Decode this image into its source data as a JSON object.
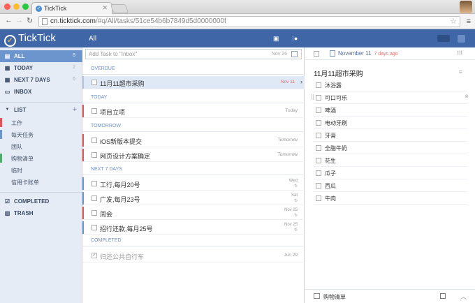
{
  "browser": {
    "tab_title": "TickTick",
    "url_host": "cn.ticktick.com",
    "url_path": "/#q/All/tasks/51ce54b6b7849d5d0000000f",
    "traffic_colors": [
      "#ff5f57",
      "#ffbd2e",
      "#28c940"
    ]
  },
  "app": {
    "logo_text": "TickTick",
    "header_title": "All",
    "accent_color": "#3f66a6"
  },
  "sidebar": {
    "smart_lists": [
      {
        "label": "ALL",
        "count": "8",
        "icon": "inbox-stack-icon",
        "active": true
      },
      {
        "label": "TODAY",
        "count": "2",
        "icon": "calendar-today-icon",
        "active": false
      },
      {
        "label": "NEXT 7 DAYS",
        "count": "6",
        "icon": "calendar-week-icon",
        "active": false
      },
      {
        "label": "INBOX",
        "count": "",
        "icon": "inbox-icon",
        "active": false
      }
    ],
    "list_header": "LIST",
    "lists": [
      {
        "label": "工作",
        "color": "#e0535b"
      },
      {
        "label": "每天任务",
        "color": "#6b95cc"
      },
      {
        "label": "团队",
        "color": ""
      },
      {
        "label": "购物清单",
        "color": "#52a96b"
      },
      {
        "label": "临时",
        "color": ""
      },
      {
        "label": "信用卡账单",
        "color": ""
      }
    ],
    "completed_label": "COMPLETED",
    "trash_label": "TRASH"
  },
  "main": {
    "add_placeholder": "Add Task to \"Inbox\"",
    "add_date": "Nov 26",
    "sections": {
      "overdue": "OVERDUE",
      "today": "TODAY",
      "tomorrow": "TOMORROW",
      "next7": "NEXT 7 DAYS",
      "completed": "COMPLETED"
    },
    "tasks": [
      {
        "title": "11月11超市采购",
        "date": "Nov 11",
        "priority_color": "#b8c5d6"
      },
      {
        "title": "项目立项",
        "date": "Today",
        "priority_color": "#e0535b"
      },
      {
        "title": "iOS新版本提交",
        "date": "Tomorrow",
        "priority_color": "#e0535b"
      },
      {
        "title": "网页设计方案确定",
        "date": "Tomorrow",
        "priority_color": "#e0535b"
      },
      {
        "title": "工行,每月20号",
        "date": "Wed",
        "priority_color": "#6b95cc"
      },
      {
        "title": "广发,每月23号",
        "date": "Sat",
        "priority_color": "#6b95cc"
      },
      {
        "title": "周会",
        "date": "Nov 25",
        "priority_color": "#e0535b"
      },
      {
        "title": "招行还款,每月25号",
        "date": "Nov 25",
        "priority_color": "#6b95cc"
      }
    ],
    "completed_tasks": [
      {
        "title": "归还公共自行车",
        "date": "Jun 29"
      }
    ]
  },
  "detail": {
    "date": "November 11",
    "ago": "7 days ago",
    "title": "11月11超市采购",
    "subtasks": [
      "沐浴露",
      "可口可乐",
      "啤酒",
      "电动牙刷",
      "牙膏",
      "全脂牛奶",
      "花生",
      "瓜子",
      "西瓜",
      "牛肉"
    ],
    "list_name": "购物清单"
  }
}
